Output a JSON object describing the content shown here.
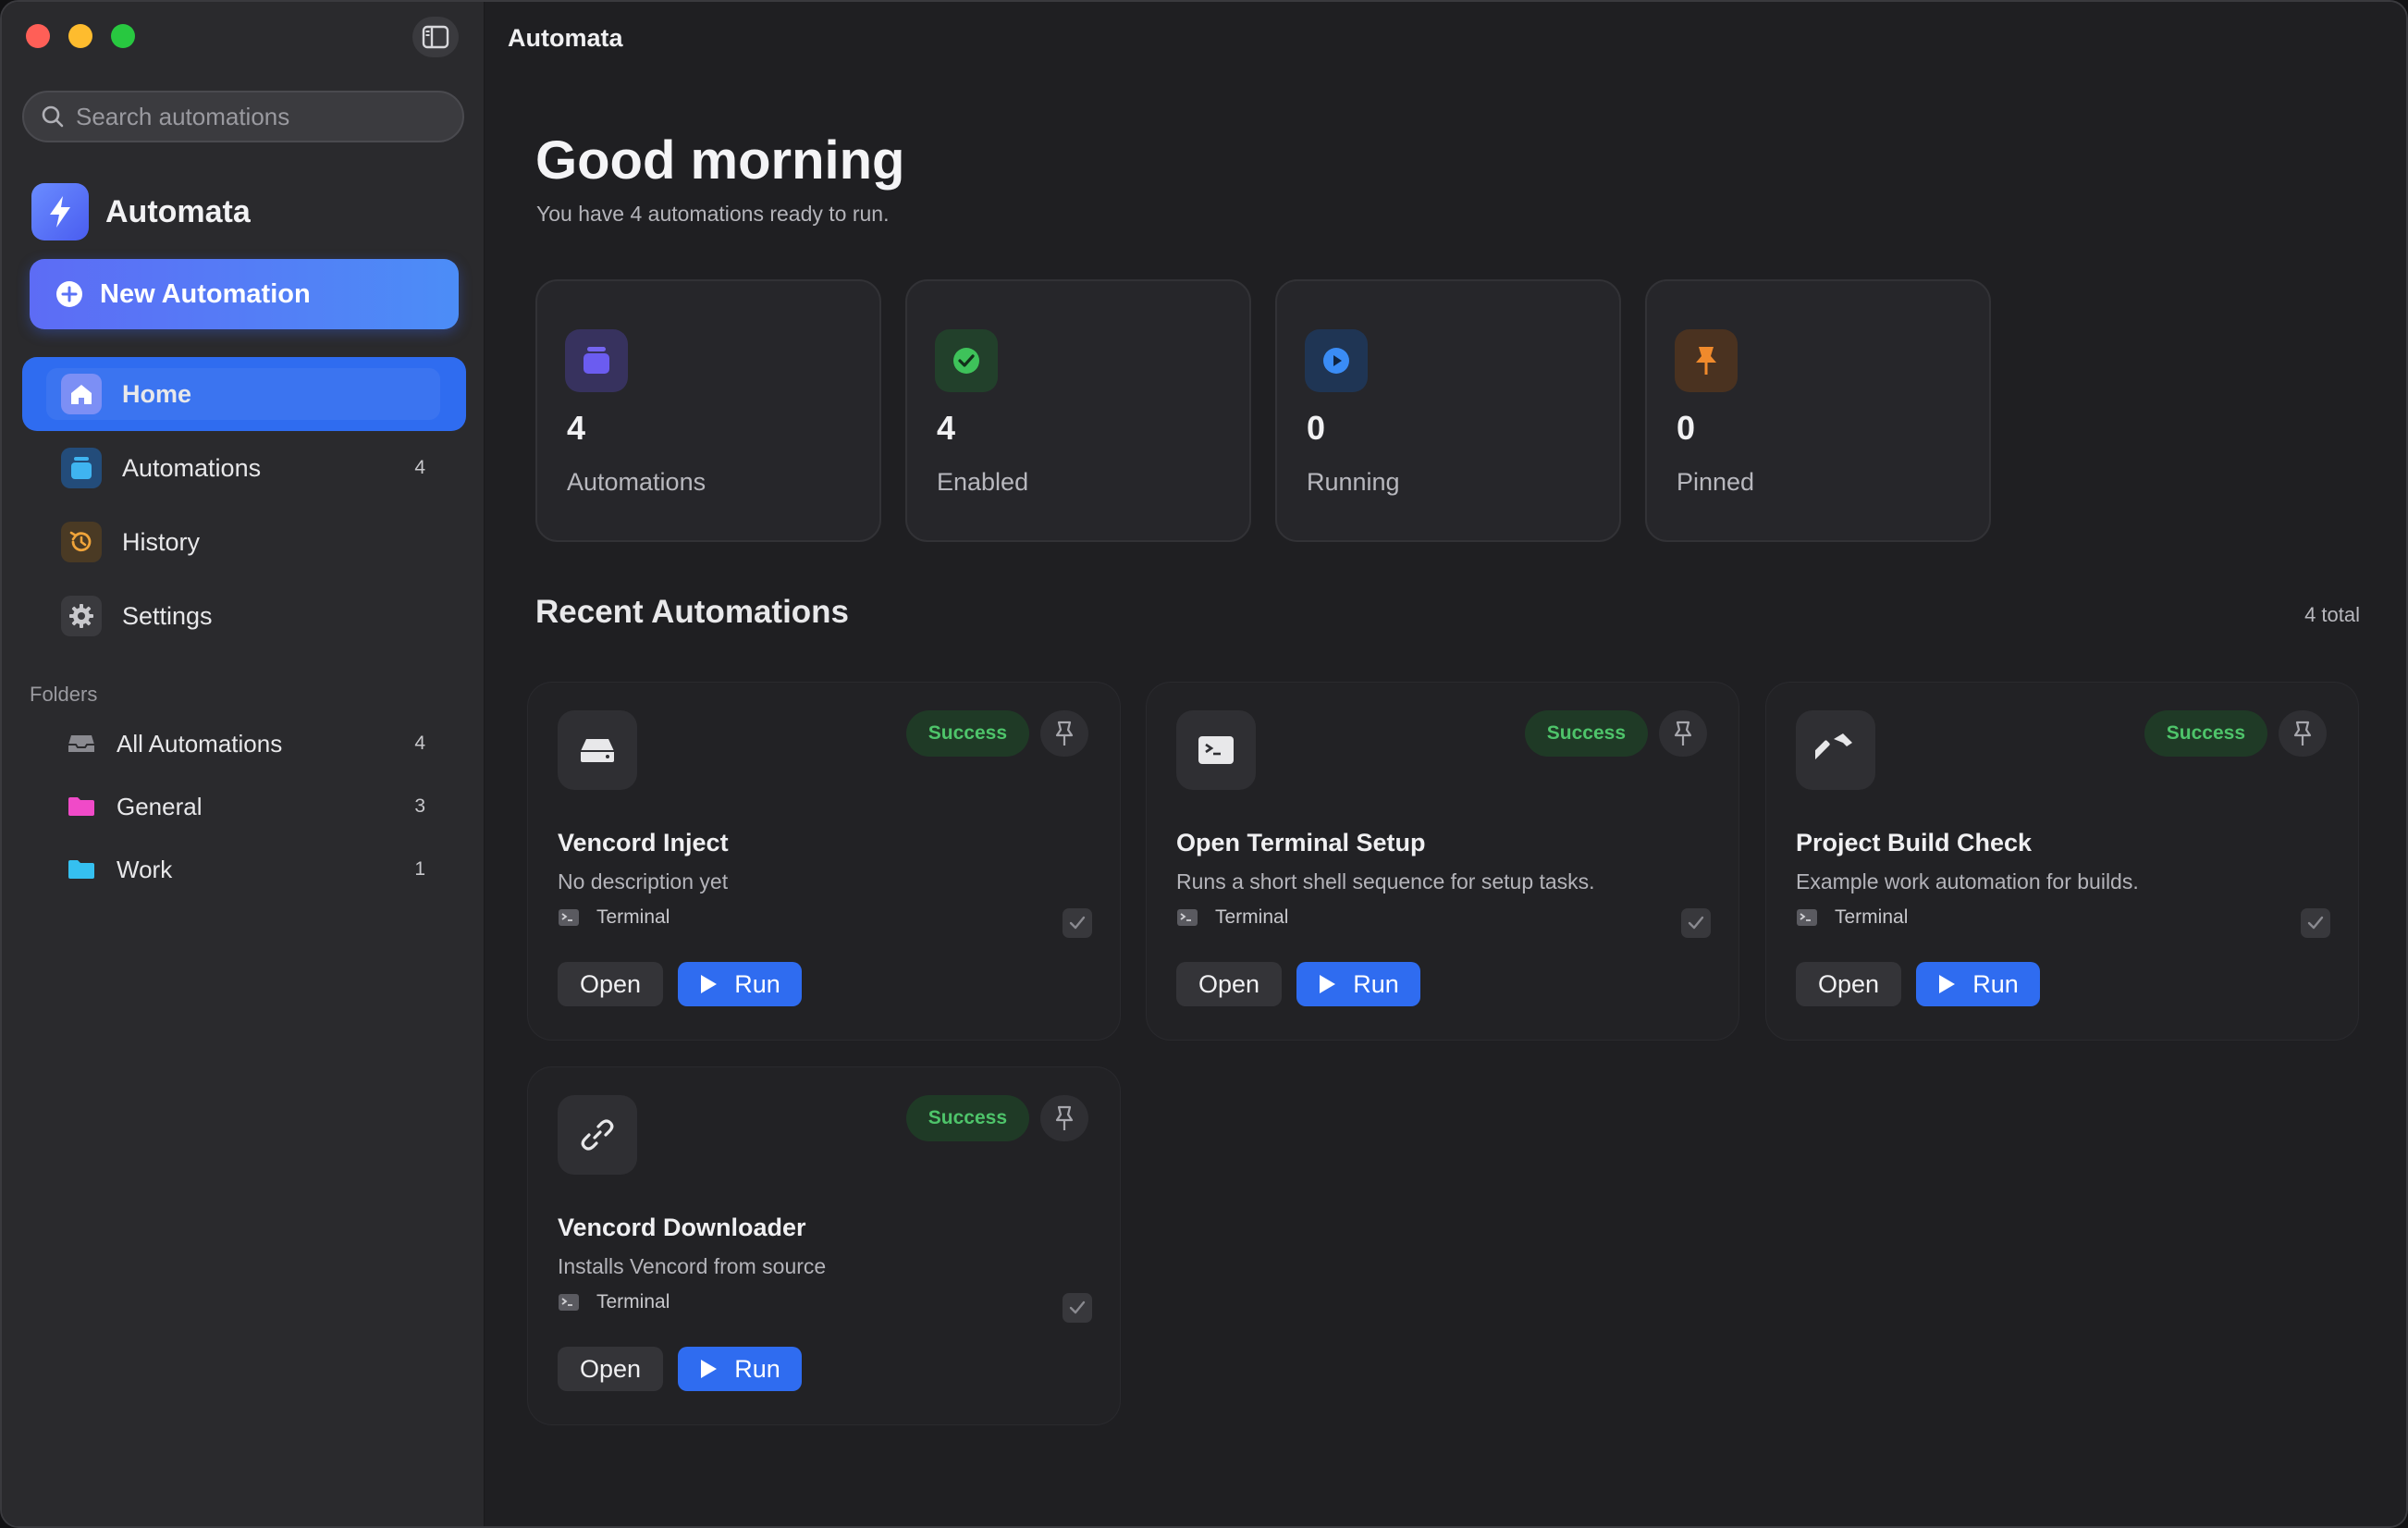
{
  "app": {
    "title": "Automata",
    "brand_name": "Automata"
  },
  "search": {
    "placeholder": "Search automations"
  },
  "sidebar": {
    "new_button_label": "New Automation",
    "nav": [
      {
        "label": "Home",
        "count": ""
      },
      {
        "label": "Automations",
        "count": "4"
      },
      {
        "label": "History",
        "count": ""
      },
      {
        "label": "Settings",
        "count": ""
      }
    ],
    "folders_title": "Folders",
    "folders": [
      {
        "label": "All Automations",
        "count": "4"
      },
      {
        "label": "General",
        "count": "3"
      },
      {
        "label": "Work",
        "count": "1"
      }
    ]
  },
  "main": {
    "greeting": "Good morning",
    "subtitle": "You have 4 automations ready to run.",
    "stats": [
      {
        "value": "4",
        "label": "Automations",
        "icon": "stack-icon",
        "color": "#6b5cf0"
      },
      {
        "value": "4",
        "label": "Enabled",
        "icon": "check-circle-icon",
        "color": "#3ec25a"
      },
      {
        "value": "0",
        "label": "Running",
        "icon": "play-circle-icon",
        "color": "#3a8cf5"
      },
      {
        "value": "0",
        "label": "Pinned",
        "icon": "pin-icon",
        "color": "#f08a2c"
      }
    ],
    "recent_title": "Recent Automations",
    "recent_total": "4 total",
    "cards": [
      {
        "title": "Vencord Inject",
        "description": "No description yet",
        "type": "Terminal",
        "status": "Success",
        "open_label": "Open",
        "run_label": "Run",
        "icon": "drive-icon"
      },
      {
        "title": "Open Terminal Setup",
        "description": "Runs a short shell sequence for setup tasks.",
        "type": "Terminal",
        "status": "Success",
        "open_label": "Open",
        "run_label": "Run",
        "icon": "terminal-icon"
      },
      {
        "title": "Project Build Check",
        "description": "Example work automation for builds.",
        "type": "Terminal",
        "status": "Success",
        "open_label": "Open",
        "run_label": "Run",
        "icon": "hammer-icon"
      },
      {
        "title": "Vencord Downloader",
        "description": "Installs Vencord from source",
        "type": "Terminal",
        "status": "Success",
        "open_label": "Open",
        "run_label": "Run",
        "icon": "link-icon"
      }
    ]
  }
}
